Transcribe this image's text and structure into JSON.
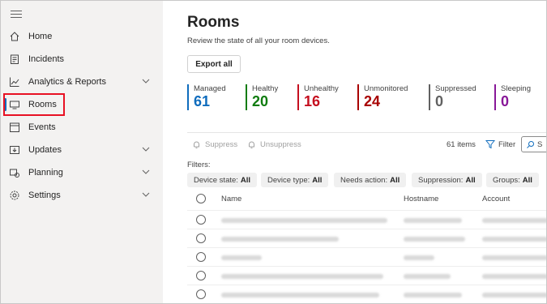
{
  "sidebar": {
    "items": [
      {
        "label": "Home",
        "icon": "home-icon"
      },
      {
        "label": "Incidents",
        "icon": "clipboard-icon"
      },
      {
        "label": "Analytics & Reports",
        "icon": "chart-icon"
      },
      {
        "label": "Rooms",
        "icon": "monitor-icon"
      },
      {
        "label": "Events",
        "icon": "calendar-icon"
      },
      {
        "label": "Updates",
        "icon": "download-icon"
      },
      {
        "label": "Planning",
        "icon": "planning-icon"
      },
      {
        "label": "Settings",
        "icon": "gear-icon"
      }
    ],
    "active": "Rooms"
  },
  "main": {
    "title": "Rooms",
    "subtitle": "Review the state of all your room devices.",
    "export_label": "Export all",
    "stats": [
      {
        "label": "Managed",
        "value": "61",
        "color": "#0f6cbd"
      },
      {
        "label": "Healthy",
        "value": "20",
        "color": "#107c10"
      },
      {
        "label": "Unhealthy",
        "value": "16",
        "color": "#c50f1f"
      },
      {
        "label": "Unmonitored",
        "value": "24",
        "color": "#a80000"
      },
      {
        "label": "Suppressed",
        "value": "0",
        "color": "#616161"
      },
      {
        "label": "Sleeping",
        "value": "0",
        "color": "#881798"
      }
    ],
    "toolbar": {
      "suppress": "Suppress",
      "unsuppress": "Unsuppress",
      "count": "61 items",
      "filter": "Filter",
      "search_placeholder": "S"
    },
    "filters_label": "Filters:",
    "chips": [
      {
        "name": "Device state:",
        "value": "All"
      },
      {
        "name": "Device type:",
        "value": "All"
      },
      {
        "name": "Needs action:",
        "value": "All"
      },
      {
        "name": "Suppression:",
        "value": "All"
      },
      {
        "name": "Groups:",
        "value": "All"
      }
    ],
    "table": {
      "columns": [
        "Name",
        "Hostname",
        "Account"
      ]
    }
  }
}
